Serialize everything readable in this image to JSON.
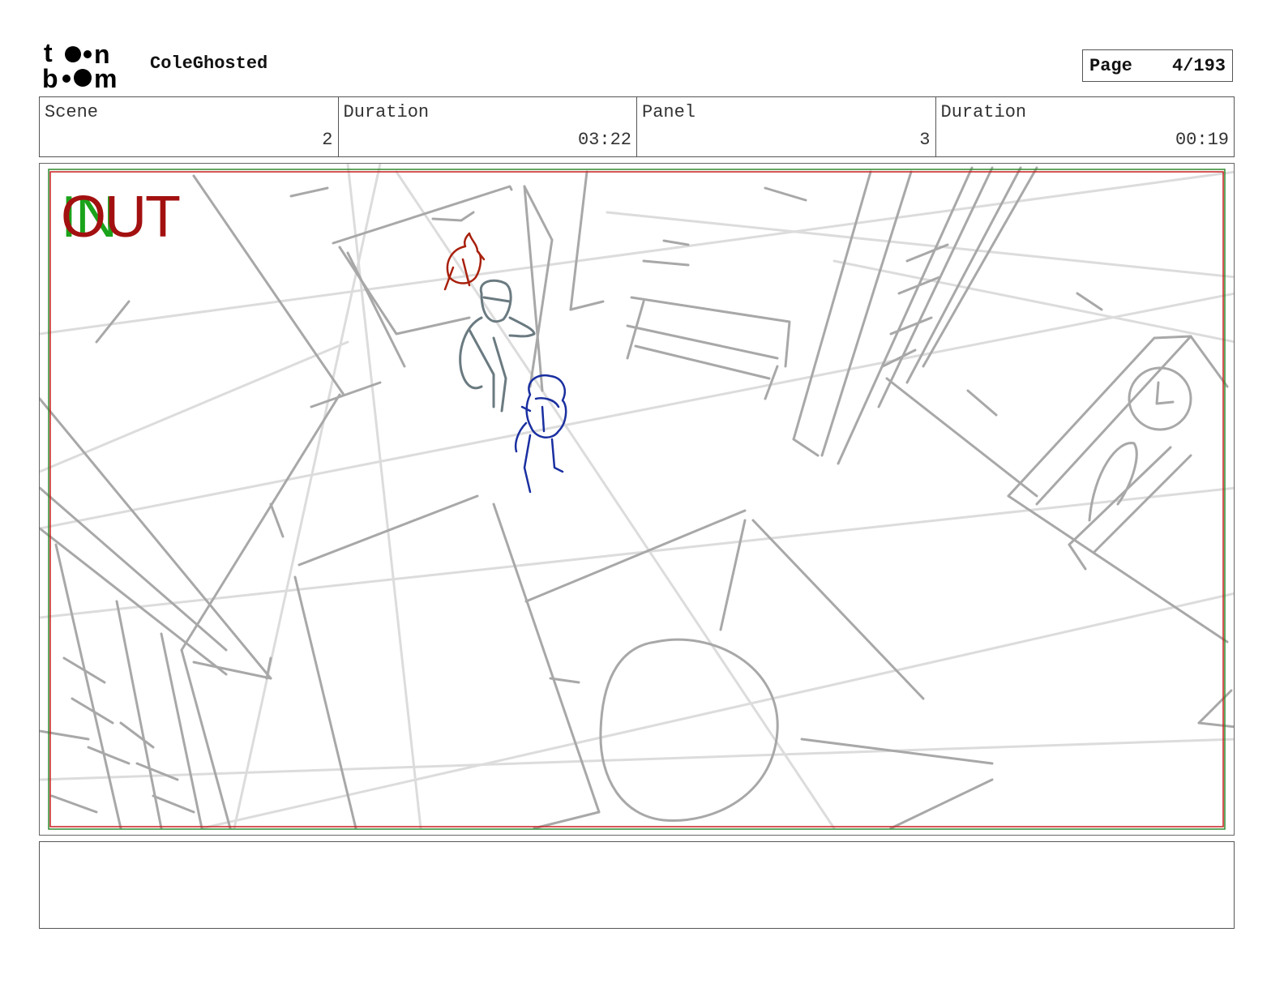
{
  "header": {
    "logo_text": "toon boom",
    "project_title": "ColeGhosted",
    "page_label": "Page",
    "page_value": "4/193"
  },
  "info": [
    {
      "label": "Scene",
      "value": "2"
    },
    {
      "label": "Duration",
      "value": "03:22"
    },
    {
      "label": "Panel",
      "value": "3"
    },
    {
      "label": "Duration",
      "value": "00:19"
    }
  ],
  "panel": {
    "in_marker": "IN",
    "out_marker": "OUT",
    "colors": {
      "sketch": "#a8a8a8",
      "sketch_light": "#dcdcdc",
      "character_red": "#a8200c",
      "character_grey": "#6a7a80",
      "character_blue": "#1a2fa0",
      "safe_red": "#c81e1e",
      "safe_green": "#2e8b2e"
    }
  },
  "notes": {
    "text": ""
  }
}
